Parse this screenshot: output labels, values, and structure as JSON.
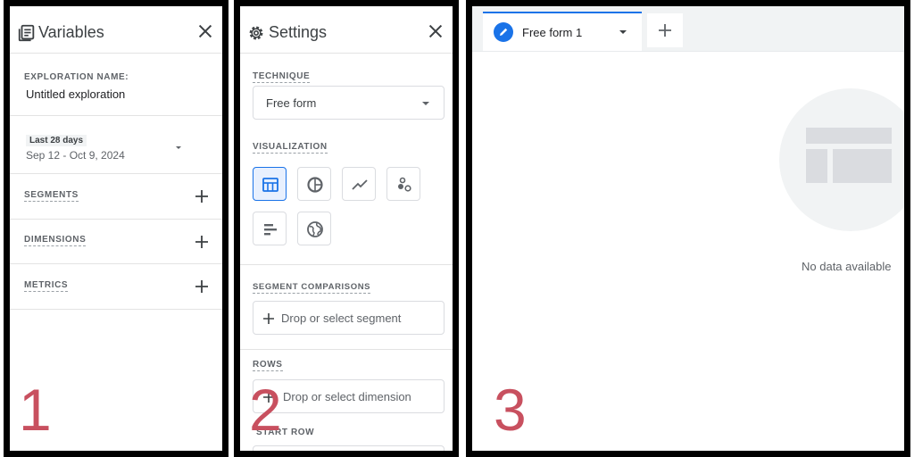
{
  "variables": {
    "title": "Variables",
    "exploration_name_label": "EXPLORATION NAME:",
    "exploration_name": "Untitled exploration",
    "date_chip": "Last 28 days",
    "date_range": "Sep 12 - Oct 9, 2024",
    "segments_label": "SEGMENTS",
    "dimensions_label": "DIMENSIONS",
    "metrics_label": "METRICS",
    "panel_number": "1"
  },
  "settings": {
    "title": "Settings",
    "technique_label": "TECHNIQUE",
    "technique_value": "Free form",
    "visualization_label": "VISUALIZATION",
    "visualizations": [
      "table",
      "donut",
      "line",
      "scatter",
      "bar",
      "geo"
    ],
    "selected_visualization": "table",
    "segment_comparisons_label": "SEGMENT COMPARISONS",
    "segment_drop": "Drop or select segment",
    "rows_label": "ROWS",
    "rows_drop": "Drop or select dimension",
    "start_row_label": "START ROW",
    "panel_number": "2"
  },
  "canvas": {
    "tab_label": "Free form 1",
    "no_data": "No data available",
    "panel_number": "3"
  },
  "colors": {
    "accent": "#1a73e8",
    "number": "#c8505f",
    "border": "#000000"
  }
}
